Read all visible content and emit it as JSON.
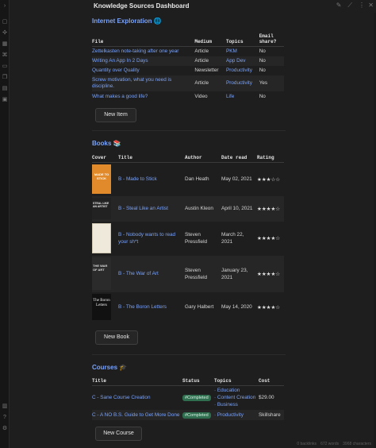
{
  "window": {
    "title": "Knowledge Sources Dashboard"
  },
  "internet": {
    "heading": "Internet Exploration 🌐",
    "headers": [
      "File",
      "Medium",
      "Topics",
      "Email share?"
    ],
    "rows": [
      {
        "file": "Zettelkasten note-taking after one year",
        "medium": "Article",
        "topics": "PKM",
        "share": "No"
      },
      {
        "file": "Writing An App In 2 Days",
        "medium": "Article",
        "topics": "App Dev",
        "share": "No"
      },
      {
        "file": "Quantity over Quality",
        "medium": "Newsletter",
        "topics": "Productivity",
        "share": "No"
      },
      {
        "file": "Screw motivation, what you need is discipline.",
        "medium": "Article",
        "topics": "Productivity",
        "share": "Yes"
      },
      {
        "file": "What makes a good life?",
        "medium": "Video",
        "topics": "Life",
        "share": "No"
      }
    ],
    "button": "New Item"
  },
  "books": {
    "heading": "Books 📚",
    "headers": [
      "Cover",
      "Title",
      "Author",
      "Date read",
      "Rating"
    ],
    "rows": [
      {
        "title": "B - Made to Stick",
        "author": "Dan Heath",
        "date": "May 02, 2021",
        "rating": "★★★☆☆",
        "cover_color": "#e08a2b",
        "cover_text": "MADE TO STICK"
      },
      {
        "title": "B - Steal Like an Artist",
        "author": "Austin Kleon",
        "date": "April 10, 2021",
        "rating": "★★★★☆",
        "cover_color": "#222222",
        "cover_text": "STEAL LIKE AN ARTIST"
      },
      {
        "title": "B - Nobody wants to read your sh*t",
        "author": "Steven Pressfield",
        "date": "March 22, 2021",
        "rating": "★★★★☆",
        "cover_color": "#efe9dc",
        "cover_text": ""
      },
      {
        "title": "B - The War of Art",
        "author": "Steven Pressfield",
        "date": "January 23, 2021",
        "rating": "★★★★☆",
        "cover_color": "#2b2b2b",
        "cover_text": "THE WAR OF ART"
      },
      {
        "title": "B - The Boron Letters",
        "author": "Gary Halbert",
        "date": "May 14, 2020",
        "rating": "★★★★☆",
        "cover_color": "#111111",
        "cover_text": "The Boron Letters"
      }
    ],
    "button": "New Book"
  },
  "courses": {
    "heading": "Courses 🎓",
    "headers": [
      "Title",
      "Status",
      "Topics",
      "Cost"
    ],
    "rows": [
      {
        "title": "C - Sane Course Creation",
        "status": "#Completed",
        "topics": [
          "Education",
          "Content Creation",
          "Business"
        ],
        "cost": "$29.00"
      },
      {
        "title": "C - A NO B.S. Guide to Get More Done",
        "status": "#Completed",
        "topics": [
          "Productivity"
        ],
        "cost": "Skillshare"
      }
    ],
    "button": "New Course"
  },
  "status": {
    "backlinks": "0 backlinks",
    "words": "672 words",
    "chars": "3968 characters"
  },
  "colors": {
    "accent": "#7aa2f7",
    "background": "#1e1e1e",
    "badge": "#2f6f4f"
  }
}
